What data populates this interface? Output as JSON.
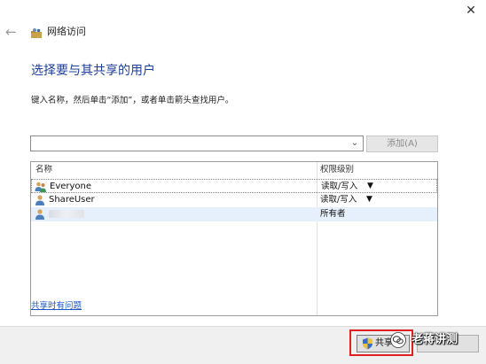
{
  "window": {
    "close_glyph": "✕",
    "back_glyph": "←",
    "title": "网络访问"
  },
  "main": {
    "heading": "选择要与其共享的用户",
    "instruction": "键入名称，然后单击“添加”，或者单击箭头查找用户。",
    "name_input": {
      "value": "",
      "placeholder": ""
    },
    "add_button_label": "添加(A)",
    "add_button_enabled": false
  },
  "table": {
    "headers": [
      "名称",
      "权限级别"
    ],
    "rows": [
      {
        "name": "Everyone",
        "permission": "读取/写入",
        "has_dropdown": true,
        "icon": "group-users-icon"
      },
      {
        "name": "ShareUser",
        "permission": "读取/写入",
        "has_dropdown": true,
        "icon": "user-icon"
      },
      {
        "name": "",
        "name_redacted": true,
        "permission": "所有者",
        "has_dropdown": false,
        "icon": "user-icon",
        "selected": true
      }
    ],
    "dropdown_glyph": "▼"
  },
  "help_link": "共享时有问题",
  "footer": {
    "share_button_label": "共享(",
    "share_icon": "uac-shield-icon",
    "cancel_button_label": ""
  },
  "watermark": {
    "text": "老蒋讲测",
    "icon": "wechat-icon"
  },
  "colors": {
    "heading": "#1f3f9e",
    "link": "#1a56c8",
    "highlight_row": "#e5f0fc",
    "red_frame": "#e02020"
  }
}
